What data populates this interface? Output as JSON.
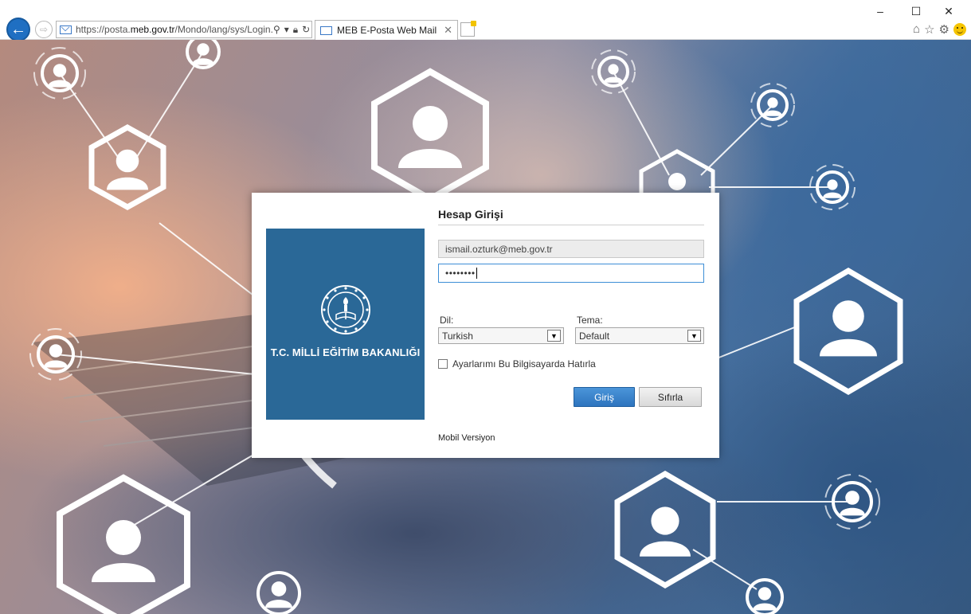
{
  "browser": {
    "url_prefix": "https://posta.",
    "url_host": "meb.gov.tr",
    "url_path": "/Mondo/lang/sys/Login.",
    "tab_title": "MEB E-Posta Web Mail",
    "window_controls": [
      "minimize-icon",
      "maximize-icon",
      "close-icon"
    ],
    "toolbar_icons": [
      "home-icon",
      "star-icon",
      "gear-icon",
      "smiley-icon"
    ]
  },
  "login": {
    "org_name": "T.C. MİLLİ EĞİTİM BAKANLIĞI",
    "title": "Hesap Girişi",
    "username_value": "ismail.ozturk@meb.gov.tr",
    "password_masked": "••••••••",
    "language_label": "Dil:",
    "language_value": "Turkish",
    "theme_label": "Tema:",
    "theme_value": "Default",
    "remember_label": "Ayarlarımı Bu Bilgisayarda Hatırla",
    "remember_checked": false,
    "login_button": "Giriş",
    "reset_button": "Sıfırla",
    "mobile_link": "Mobil Versiyon"
  },
  "colors": {
    "accent_blue": "#2d74be",
    "logo_bg": "#2a6897",
    "browser_back": "#1f6fc2"
  }
}
